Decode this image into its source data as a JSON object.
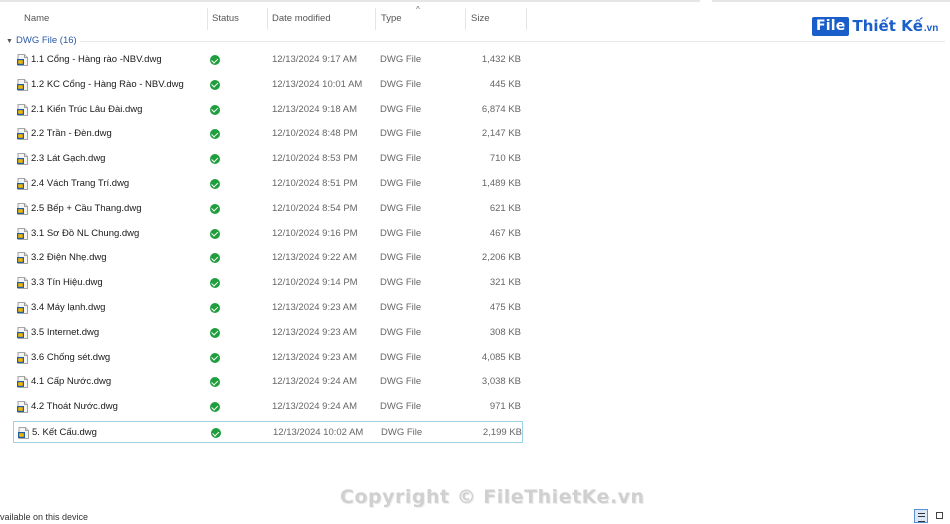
{
  "header": {
    "columns": {
      "name": "Name",
      "status": "Status",
      "date": "Date modified",
      "type": "Type",
      "size": "Size"
    },
    "sort_indicator": "^"
  },
  "logo": {
    "file": "File",
    "brand": "Thiết Kế",
    "tld": ".vn"
  },
  "group": {
    "label": "DWG File (16)"
  },
  "files": [
    {
      "name": "1.1 Cổng - Hàng rào -NBV.dwg",
      "date": "12/13/2024 9:17 AM",
      "type": "DWG File",
      "size": "1,432 KB"
    },
    {
      "name": "1.2 KC Cổng - Hàng Rào - NBV.dwg",
      "date": "12/13/2024 10:01 AM",
      "type": "DWG File",
      "size": "445 KB"
    },
    {
      "name": "2.1 Kiến Trúc Lâu Đài.dwg",
      "date": "12/13/2024 9:18 AM",
      "type": "DWG File",
      "size": "6,874 KB"
    },
    {
      "name": "2.2 Trần - Đèn.dwg",
      "date": "12/10/2024 8:48 PM",
      "type": "DWG File",
      "size": "2,147 KB"
    },
    {
      "name": "2.3 Lát Gạch.dwg",
      "date": "12/10/2024 8:53 PM",
      "type": "DWG File",
      "size": "710 KB"
    },
    {
      "name": "2.4 Vách Trang Trí.dwg",
      "date": "12/10/2024 8:51 PM",
      "type": "DWG File",
      "size": "1,489 KB"
    },
    {
      "name": "2.5 Bếp + Cầu Thang.dwg",
      "date": "12/10/2024 8:54 PM",
      "type": "DWG File",
      "size": "621 KB"
    },
    {
      "name": "3.1 Sơ Đồ NL Chung.dwg",
      "date": "12/10/2024 9:16 PM",
      "type": "DWG File",
      "size": "467 KB"
    },
    {
      "name": "3.2 Điện Nhẹ.dwg",
      "date": "12/13/2024 9:22 AM",
      "type": "DWG File",
      "size": "2,206 KB"
    },
    {
      "name": "3.3 Tín Hiệu.dwg",
      "date": "12/10/2024 9:14 PM",
      "type": "DWG File",
      "size": "321 KB"
    },
    {
      "name": "3.4 Máy lạnh.dwg",
      "date": "12/13/2024 9:23 AM",
      "type": "DWG File",
      "size": "475 KB"
    },
    {
      "name": "3.5 Internet.dwg",
      "date": "12/13/2024 9:23 AM",
      "type": "DWG File",
      "size": "308 KB"
    },
    {
      "name": "3.6 Chống sét.dwg",
      "date": "12/13/2024 9:23 AM",
      "type": "DWG File",
      "size": "4,085 KB"
    },
    {
      "name": "4.1 Cấp Nước.dwg",
      "date": "12/13/2024 9:24 AM",
      "type": "DWG File",
      "size": "3,038 KB"
    },
    {
      "name": "4.2 Thoát Nước.dwg",
      "date": "12/13/2024 9:24 AM",
      "type": "DWG File",
      "size": "971 KB"
    },
    {
      "name": "5. Kết Cấu.dwg",
      "date": "12/13/2024 10:02 AM",
      "type": "DWG File",
      "size": "2,199 KB",
      "selected": true
    }
  ],
  "watermark": "Copyright © FileThietKe.vn",
  "status_bar": {
    "text": "vailable on this device"
  },
  "icons": {
    "file": "dwg-file-icon",
    "status": "synced-check-icon",
    "view_details": "details-view-icon",
    "view_tiles": "tiles-view-icon"
  },
  "colors": {
    "status_ok": "#1e9e3c",
    "group_label": "#2a5aa8",
    "selection_border": "#9fd1e6",
    "brand_blue": "#1a5fc9"
  }
}
